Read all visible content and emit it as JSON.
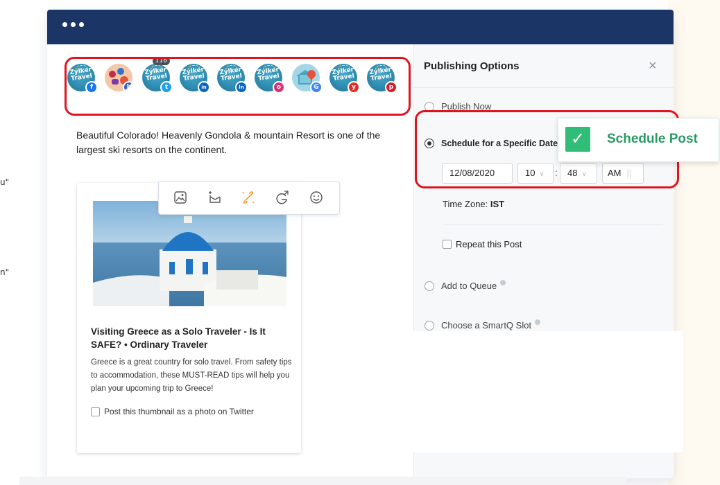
{
  "edge_marks": [
    "u\"",
    "n\""
  ],
  "window": {
    "menu_dots": "..."
  },
  "accounts": [
    {
      "type": "zylker",
      "logo_text": "Zylker Travel",
      "network": "facebook",
      "badge_color": "#1877f2",
      "badge_glyph": "f"
    },
    {
      "type": "avatar",
      "network": "instagram-business",
      "badge_color": "#3b5fc4",
      "badge_glyph": "b"
    },
    {
      "type": "zylker",
      "logo_text": "Zylker Travel",
      "network": "twitter",
      "badge_color": "#1da1f2",
      "badge_glyph": "t",
      "count": "116"
    },
    {
      "type": "zylker",
      "logo_text": "Zylker Travel",
      "network": "linkedin",
      "badge_color": "#0a66c2",
      "badge_glyph": "in"
    },
    {
      "type": "zylker",
      "logo_text": "Zylker Travel",
      "network": "linkedin-page",
      "badge_color": "#0a66c2",
      "badge_glyph": "ln"
    },
    {
      "type": "zylker",
      "logo_text": "Zylker Travel",
      "network": "instagram",
      "badge_color": "#d9317a",
      "badge_glyph": "o"
    },
    {
      "type": "gmb",
      "network": "google",
      "badge_color": "#4285f4",
      "badge_glyph": "G"
    },
    {
      "type": "zylker",
      "logo_text": "Zylker Travel",
      "network": "youtube",
      "badge_color": "#e52d27",
      "badge_glyph": "y"
    },
    {
      "type": "zylker",
      "logo_text": "Zylker Travel",
      "network": "pinterest",
      "badge_color": "#d0202f",
      "badge_glyph": "p"
    }
  ],
  "post": {
    "text": "Beautiful Colorado! Heavenly Gondola & mountain Resort is one of the largest ski resorts on the continent."
  },
  "toolbar": {
    "icons": [
      "image-icon",
      "add-link-preview-icon",
      "unlink-icon",
      "google-icon",
      "emoji-icon"
    ]
  },
  "link_card": {
    "title": "Visiting Greece as a Solo Traveler - Is It SAFE? • Ordinary Traveler",
    "description": "Greece is a great country for solo travel. From safety tips to accommodation, these MUST-READ tips will help you plan your upcoming trip to Greece!",
    "twitter_photo_option": "Post this thumbnail as a photo on Twitter"
  },
  "publishing": {
    "title": "Publishing Options",
    "close_glyph": "×",
    "publish_now": "Publish Now",
    "schedule_label": "Schedule for a Specific Date",
    "date": "12/08/2020",
    "hour": "10",
    "minute": "48",
    "ampm": "AM",
    "timezone_label": "Time Zone:",
    "timezone_value": "IST",
    "repeat_label": "Repeat this Post",
    "add_to_queue": "Add to Queue",
    "smartq": "Choose a SmartQ Slot"
  },
  "toast": {
    "message": "Schedule Post",
    "color": "#2fbd78"
  },
  "colors": {
    "header": "#1b3566",
    "highlight": "#e0141e"
  }
}
